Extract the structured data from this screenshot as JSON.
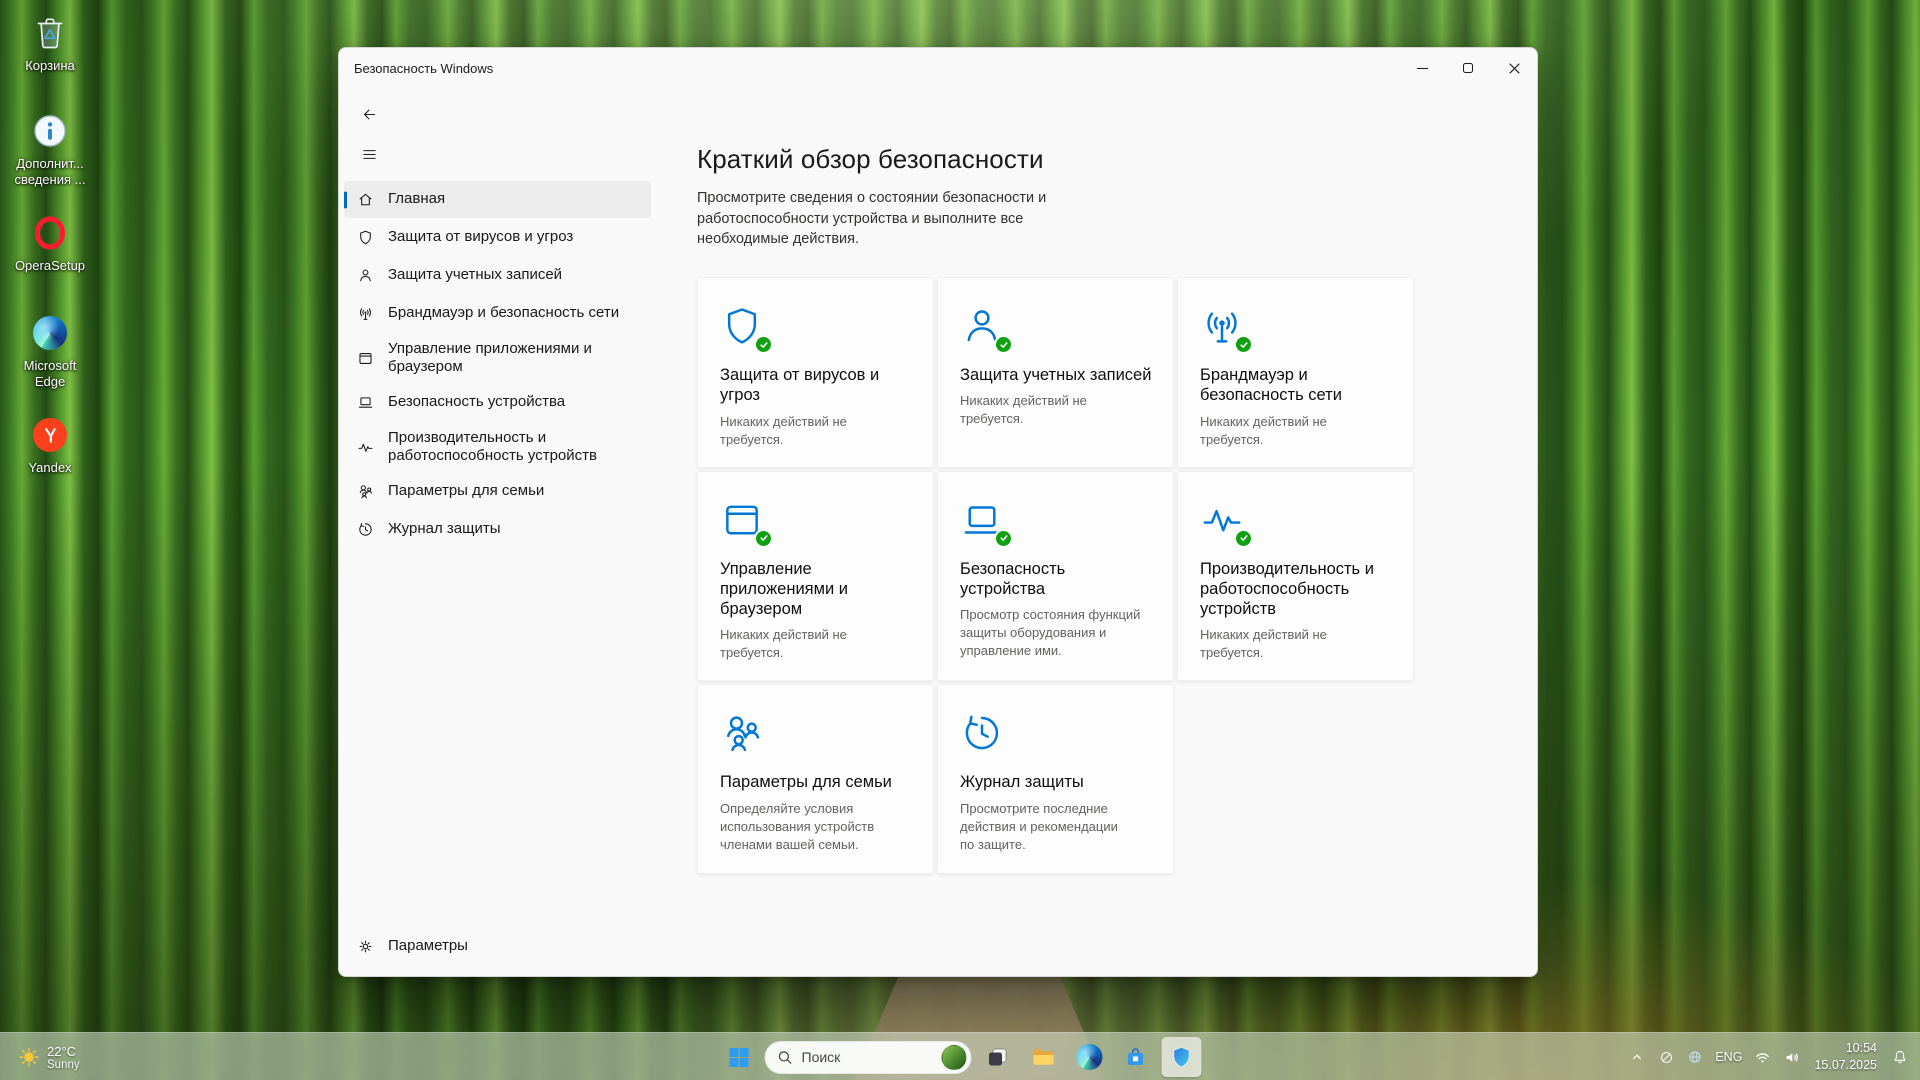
{
  "theme": {
    "accent": "#0067C0",
    "icon-blue": "#0077D6",
    "ok-green": "#10A010"
  },
  "desktop": {
    "icons": [
      {
        "icon": "recycle-bin",
        "label": "Корзина"
      },
      {
        "icon": "info-shortcut",
        "label": "Дополнит... сведения ..."
      },
      {
        "icon": "opera-setup",
        "label": "OperaSetup"
      },
      {
        "icon": "microsoft-edge",
        "label": "Microsoft Edge"
      },
      {
        "icon": "yandex",
        "label": "Yandex"
      }
    ]
  },
  "window": {
    "title": "Безопасность Windows",
    "sidebar": {
      "items": [
        {
          "icon": "home",
          "label": "Главная",
          "selected": true
        },
        {
          "icon": "shield",
          "label": "Защита от вирусов и угроз"
        },
        {
          "icon": "person",
          "label": "Защита учетных записей"
        },
        {
          "icon": "network",
          "label": "Брандмауэр и безопасность сети"
        },
        {
          "icon": "browser",
          "label": "Управление приложениями и браузером"
        },
        {
          "icon": "laptop",
          "label": "Безопасность устройства"
        },
        {
          "icon": "pulse",
          "label": "Производительность и работоспособность устройств"
        },
        {
          "icon": "family",
          "label": "Параметры для семьи"
        },
        {
          "icon": "history",
          "label": "Журнал защиты"
        }
      ],
      "settings_label": "Параметры"
    },
    "main": {
      "title": "Краткий обзор безопасности",
      "subtitle": "Просмотрите сведения о состоянии безопасности и работоспособности устройства и выполните все необходимые действия.",
      "cards": [
        {
          "icon": "shield",
          "title": "Защита от вирусов и угроз",
          "description": "Никаких действий не требуется.",
          "status": "ok"
        },
        {
          "icon": "person",
          "title": "Защита учетных записей",
          "description": "Никаких действий не требуется.",
          "status": "ok"
        },
        {
          "icon": "network",
          "title": "Брандмауэр и безопасность сети",
          "description": "Никаких действий не требуется.",
          "status": "ok"
        },
        {
          "icon": "browser",
          "title": "Управление приложениями и браузером",
          "description": "Никаких действий не требуется.",
          "status": "ok"
        },
        {
          "icon": "laptop",
          "title": "Безопасность устройства",
          "description": "Просмотр состояния функций защиты оборудования и управление ими.",
          "status": "ok"
        },
        {
          "icon": "pulse",
          "title": "Производительность и работоспособность устройств",
          "description": "Никаких действий не требуется.",
          "status": "ok"
        },
        {
          "icon": "family",
          "title": "Параметры для семьи",
          "description": "Определяйте условия использования устройств членами вашей семьи.",
          "status": "none"
        },
        {
          "icon": "history",
          "title": "Журнал защиты",
          "description": "Просмотрите последние действия и рекомендации по защите.",
          "status": "none"
        }
      ]
    }
  },
  "taskbar": {
    "weather": {
      "temp": "22°C",
      "condition": "Sunny"
    },
    "search_placeholder": "Поиск",
    "tray": {
      "language": "ENG",
      "time": "10:54",
      "date": "15.07.2025"
    }
  }
}
